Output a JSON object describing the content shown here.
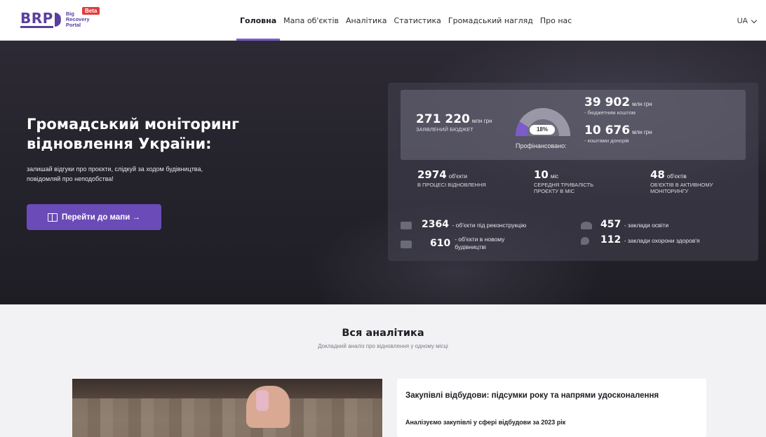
{
  "header": {
    "logo_mark": "BRP",
    "logo_text_lines": [
      "Big",
      "Recovery",
      "Portal"
    ],
    "beta": "Beta",
    "nav": [
      {
        "label": "Головна",
        "active": true
      },
      {
        "label": "Мапа об'єктів",
        "active": false
      },
      {
        "label": "Аналітика",
        "active": false
      },
      {
        "label": "Статистика",
        "active": false
      },
      {
        "label": "Громадський нагляд",
        "active": false
      },
      {
        "label": "Про нас",
        "active": false
      }
    ],
    "language": "UA"
  },
  "hero": {
    "title": "Громадський моніторинг відновлення України:",
    "subtitle": "залишай відгуки про проєкти, слідкуй за ходом будівництва, повідомляй про неподобства!",
    "button_label": "Перейти до мапи →"
  },
  "stats": {
    "declared_budget": {
      "value": "271 220",
      "unit": "млн грн",
      "caption": "ЗАЯВЛЕНИЙ БЮДЖЕТ"
    },
    "financed": {
      "percent": "18%",
      "percent_value": 18,
      "label": "Профінансовано:"
    },
    "budget_funds": {
      "value": "39 902",
      "unit": "млн грн",
      "caption": "- бюджетним коштом"
    },
    "donor_funds": {
      "value": "10 676",
      "unit": "млн грн",
      "caption": "- коштами донорів"
    },
    "in_recovery": {
      "value": "2974",
      "unit": "об'єкти",
      "caption": "В ПРОЦЕСІ ВІДНОВЛЕННЯ"
    },
    "avg_duration": {
      "value": "10",
      "unit": "міс",
      "caption": "СЕРЕДНЯ ТРИВАЛІСТЬ ПРОЄКТУ В МІС"
    },
    "monitored": {
      "value": "48",
      "unit": "об'єктів",
      "caption": "ОБ'ЄКТІВ В АКТИВНОМУ МОНІТОРИНГУ"
    },
    "reconstruction": {
      "value": "2364",
      "text": "- об'єкти під реконструкцію"
    },
    "new_build": {
      "value": "610",
      "text": "- об'єкти в новому будівництві"
    },
    "education": {
      "value": "457",
      "text": "- заклади освіти"
    },
    "healthcare": {
      "value": "112",
      "text": "- заклади охорони здоров'я"
    }
  },
  "analytics": {
    "title": "Вся аналітика",
    "subtitle": "Докладний аналіз про відновлення у одному місці",
    "card": {
      "title": "Закупівлі відбудови: підсумки року та напрями удосконалення",
      "subtitle": "Аналізуємо закупівлі у сфері відбудови за 2023 рік"
    }
  }
}
